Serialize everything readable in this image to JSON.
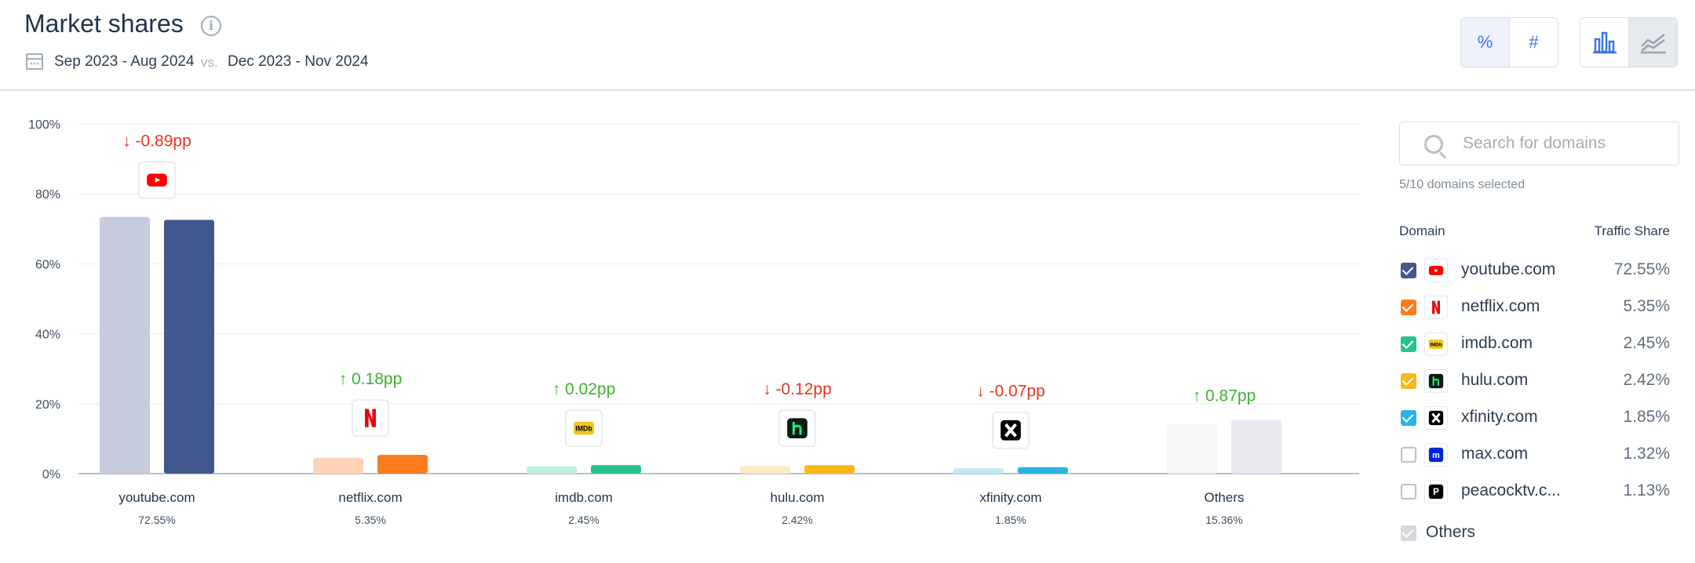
{
  "header": {
    "title": "Market shares",
    "date_range_1": "Sep 2023 - Aug 2024",
    "vs": "vs.",
    "date_range_2": "Dec 2023 - Nov 2024",
    "metric_toggle": {
      "percent_label": "%",
      "count_label": "#",
      "selected": "%"
    },
    "chart_type_toggle": {
      "selected": "bar"
    }
  },
  "chart_data": {
    "type": "bar",
    "categories": [
      "youtube.com",
      "netflix.com",
      "imdb.com",
      "hulu.com",
      "xfinity.com",
      "Others"
    ],
    "category_values": [
      "72.55%",
      "5.35%",
      "2.45%",
      "2.42%",
      "1.85%",
      "15.36%"
    ],
    "series": [
      {
        "values": [
          73.4,
          4.5,
          2.1,
          2.2,
          1.5,
          14.0
        ]
      },
      {
        "values": [
          72.55,
          5.35,
          2.45,
          2.42,
          1.85,
          15.36
        ]
      }
    ],
    "changes": [
      "-0.89pp",
      "0.18pp",
      "0.02pp",
      "-0.12pp",
      "-0.07pp",
      "0.87pp"
    ],
    "change_directions": [
      "down",
      "up",
      "up",
      "down",
      "down",
      "up"
    ],
    "y_ticks": [
      "0%",
      "20%",
      "40%",
      "60%",
      "80%",
      "100%"
    ],
    "ylim": [
      0,
      100
    ],
    "grid": true,
    "colors_current": [
      "#43578f",
      "#fb7b1e",
      "#25c48d",
      "#fbb717",
      "#26b6e1",
      "#e7e9ec"
    ],
    "colors_previous": [
      "#c6cbdd",
      "#fed3b7",
      "#bfede0",
      "#fdeac4",
      "#c1e8f5",
      "#f5f6f7"
    ],
    "up_color": "#3cb22d",
    "down_color": "#e8351f"
  },
  "sidebar": {
    "search_placeholder": "Search for domains",
    "selected_count": "5/10 domains selected",
    "col_domain": "Domain",
    "col_share": "Traffic Share",
    "domains": [
      {
        "name": "youtube.com",
        "share": "72.55%",
        "checked": true,
        "color": "#43578f",
        "icon": "youtube-icon"
      },
      {
        "name": "netflix.com",
        "share": "5.35%",
        "checked": true,
        "color": "#fb7b1e",
        "icon": "netflix-icon"
      },
      {
        "name": "imdb.com",
        "share": "2.45%",
        "checked": true,
        "color": "#25c48d",
        "icon": "imdb-icon"
      },
      {
        "name": "hulu.com",
        "share": "2.42%",
        "checked": true,
        "color": "#fbb717",
        "icon": "hulu-icon"
      },
      {
        "name": "xfinity.com",
        "share": "1.85%",
        "checked": true,
        "color": "#26b6e1",
        "icon": "xfinity-icon"
      },
      {
        "name": "max.com",
        "share": "1.32%",
        "checked": false,
        "color": "#b9c2cc",
        "icon": "max-icon"
      },
      {
        "name": "peacocktv.c...",
        "share": "1.13%",
        "checked": false,
        "color": "#b9c2cc",
        "icon": "peacock-icon"
      }
    ],
    "others_label": "Others"
  }
}
